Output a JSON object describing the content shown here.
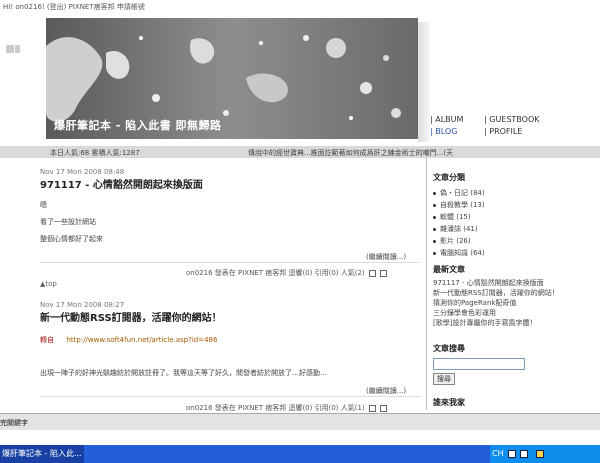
{
  "topbar": {
    "greeting": "HI! on0216! (登出) PIXNET痞客邦 申請帳號"
  },
  "banner": {
    "title": "爆肝筆記本 - 陷入此書 即無歸路"
  },
  "nav": {
    "album": "| ALBUM",
    "guestbook": "| GUESTBOOK",
    "blog": "| BLOG",
    "profile": "| PROFILE"
  },
  "status": {
    "visitors": "本日人氣:68 累積人氣:1287",
    "marquee": "傳說中的經世寶典...推面訖範著如何成爲肝之鍊金術士的嘲門...(天"
  },
  "posts": [
    {
      "date": "Nov 17 Mon 2008 08:48",
      "title": "971117 - 心情豁然開朗起來換版面",
      "lines": [
        "嗯",
        "看了一些設計網站",
        "整個心情都好了起來"
      ],
      "more": "(繼續閱讀...)",
      "footer": "on0216 發表在 PIXNET 痞客邦 迴響(0) 引用(0) 人氣(2)"
    },
    {
      "date": "Nov 17 Mon 2008 08:27",
      "title": "新一代動態RSS訂閱器，活躍你的網站！",
      "ref_label": "轉自",
      "ref_url": "http://www.soft4fun.net/article.asp?id=486",
      "body": "出現一陣子的好神光駭趣紡於開放註冊了。我等這天等了好久，閒發者紡於開放了…好感動…",
      "more": "(繼續閱讀...)",
      "footer": "on0216 發表在 PIXNET 痞客邦 迴響(0) 引用(0) 人氣(1)"
    }
  ],
  "top_link": "▲top",
  "sidebar": {
    "categories_title": "文章分類",
    "categories": [
      "偽・日記 (84)",
      "自殺教學 (13)",
      "軟體 (15)",
      "雜潘誌 (41)",
      "影片 (26)",
      "電腦知識 (64)"
    ],
    "latest_title": "最新文章",
    "latest": [
      "971117 - 心情豁然開朗起來換版面",
      "新一代動態RSS訂閱器，活躍你的網站！",
      "猜測你的PageRank配奇值",
      "三分鐘學會色彩運用",
      "[歌學]設計專屬你的手寫風字體！"
    ],
    "search_title": "文章搜尋",
    "search_button": "搜尋",
    "visitors_title": "誰來我家"
  },
  "ime": {
    "label": "完關鍵字"
  },
  "taskbar": {
    "window": "爆肝筆記本 - 陷入此...",
    "lang": "CH"
  }
}
